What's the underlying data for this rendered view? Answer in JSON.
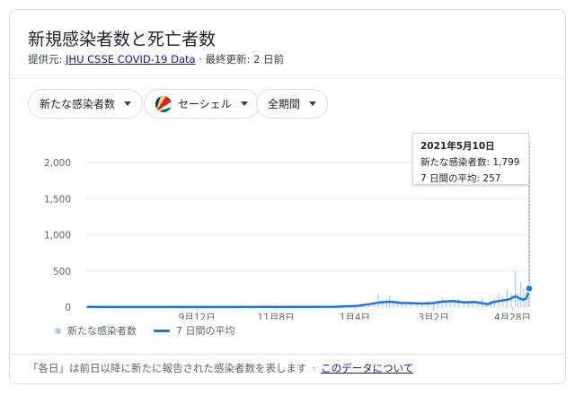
{
  "header": {
    "title": "新規感染者数と死亡者数",
    "source_prefix": "提供元: ",
    "source_link": "JHU CSSE COVID-19 Data",
    "updated": " · 最終更新: 2 日前"
  },
  "filters": {
    "metric": "新たな感染者数",
    "region": "セーシェル",
    "period": "全期間"
  },
  "tooltip": {
    "date": "2021年5月10日",
    "new_cases": "新たな感染者数: 1,799",
    "avg": "7 日間の平均: 257"
  },
  "legend": {
    "bars": "新たな感染者数",
    "line": "7 日間の平均"
  },
  "footer": {
    "note": "「各日」は前日以降に新たに報告された感染者数を表します",
    "sep": "·",
    "link": "このデータについて"
  },
  "colors": {
    "bar": "#a6c8ff",
    "line": "#1a73e8",
    "grid": "#e8eaed",
    "axis_text": "#5f6368"
  },
  "chart_data": {
    "type": "bar",
    "x_ticks": [
      "9月12日",
      "11月8日",
      "1月4日",
      "3月2日",
      "4月28日"
    ],
    "y_ticks": [
      "0",
      "500",
      "1,000",
      "1,500",
      "2,000"
    ],
    "ylim": [
      0,
      2000
    ],
    "series": [
      {
        "name": "新たな感染者数",
        "points": [
          [
            "2020-12-15",
            3
          ],
          [
            "2020-12-22",
            5
          ],
          [
            "2020-12-28",
            8
          ],
          [
            "2021-01-04",
            20
          ],
          [
            "2021-01-10",
            30
          ],
          [
            "2021-01-14",
            45
          ],
          [
            "2021-01-18",
            60
          ],
          [
            "2021-01-21",
            180
          ],
          [
            "2021-01-24",
            80
          ],
          [
            "2021-01-27",
            120
          ],
          [
            "2021-01-29",
            150
          ],
          [
            "2021-02-01",
            70
          ],
          [
            "2021-02-04",
            90
          ],
          [
            "2021-02-07",
            60
          ],
          [
            "2021-02-10",
            75
          ],
          [
            "2021-02-14",
            50
          ],
          [
            "2021-02-18",
            65
          ],
          [
            "2021-02-22",
            45
          ],
          [
            "2021-02-26",
            80
          ],
          [
            "2021-03-02",
            60
          ],
          [
            "2021-03-05",
            90
          ],
          [
            "2021-03-08",
            130
          ],
          [
            "2021-03-11",
            80
          ],
          [
            "2021-03-14",
            100
          ],
          [
            "2021-03-17",
            70
          ],
          [
            "2021-03-20",
            110
          ],
          [
            "2021-03-24",
            60
          ],
          [
            "2021-03-27",
            90
          ],
          [
            "2021-03-30",
            100
          ],
          [
            "2021-04-03",
            70
          ],
          [
            "2021-04-06",
            120
          ],
          [
            "2021-04-09",
            60
          ],
          [
            "2021-04-12",
            90
          ],
          [
            "2021-04-15",
            110
          ],
          [
            "2021-04-18",
            200
          ],
          [
            "2021-04-21",
            150
          ],
          [
            "2021-04-24",
            250
          ],
          [
            "2021-04-27",
            180
          ],
          [
            "2021-04-30",
            500
          ],
          [
            "2021-05-02",
            200
          ],
          [
            "2021-05-04",
            350
          ],
          [
            "2021-05-06",
            250
          ],
          [
            "2021-05-08",
            100
          ],
          [
            "2021-05-10",
            1799
          ]
        ]
      },
      {
        "name": "7 日間の平均",
        "points": [
          [
            "2020-06-25",
            2
          ],
          [
            "2020-09-01",
            1
          ],
          [
            "2020-11-01",
            2
          ],
          [
            "2020-12-01",
            3
          ],
          [
            "2020-12-20",
            5
          ],
          [
            "2021-01-05",
            15
          ],
          [
            "2021-01-14",
            40
          ],
          [
            "2021-01-22",
            65
          ],
          [
            "2021-01-30",
            75
          ],
          [
            "2021-02-06",
            60
          ],
          [
            "2021-02-14",
            55
          ],
          [
            "2021-02-22",
            50
          ],
          [
            "2021-03-01",
            55
          ],
          [
            "2021-03-08",
            75
          ],
          [
            "2021-03-16",
            85
          ],
          [
            "2021-03-24",
            65
          ],
          [
            "2021-04-01",
            70
          ],
          [
            "2021-04-06",
            55
          ],
          [
            "2021-04-10",
            40
          ],
          [
            "2021-04-14",
            70
          ],
          [
            "2021-04-20",
            90
          ],
          [
            "2021-04-26",
            110
          ],
          [
            "2021-04-30",
            150
          ],
          [
            "2021-05-03",
            120
          ],
          [
            "2021-05-06",
            100
          ],
          [
            "2021-05-08",
            120
          ],
          [
            "2021-05-10",
            257
          ]
        ]
      }
    ],
    "highlight": [
      "2021-05-10",
      257
    ]
  }
}
